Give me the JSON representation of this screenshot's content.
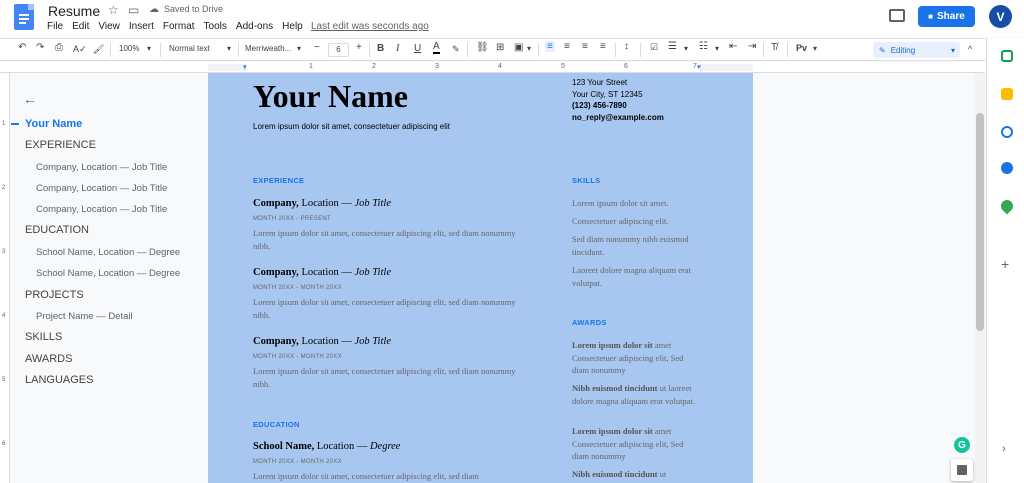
{
  "app": {
    "doc_title": "Resume",
    "saved_status": "Saved to Drive",
    "last_edit": "Last edit was seconds ago",
    "share_label": "Share",
    "avatar_initial": "V",
    "accent_color": "#1a73e8",
    "page_highlight_color": "#a8c7f0"
  },
  "menu": [
    "File",
    "Edit",
    "View",
    "Insert",
    "Format",
    "Tools",
    "Add-ons",
    "Help"
  ],
  "toolbar": {
    "zoom": "100%",
    "style": "Normal text",
    "font": "Merriweath...",
    "font_size": "6",
    "mode": "Editing"
  },
  "ruler": {
    "numbers": [
      "1",
      "1",
      "2",
      "3",
      "4",
      "5",
      "6",
      "7"
    ]
  },
  "vruler": {
    "numbers": [
      "1",
      "2",
      "3",
      "4",
      "5",
      "6"
    ]
  },
  "outline": {
    "active": "Your Name",
    "items": [
      {
        "level": "h",
        "label": "EXPERIENCE"
      },
      {
        "level": "s",
        "label": "Company, Location — Job Title"
      },
      {
        "level": "s",
        "label": "Company, Location — Job Title"
      },
      {
        "level": "s",
        "label": "Company, Location — Job Title"
      },
      {
        "level": "h",
        "label": "EDUCATION"
      },
      {
        "level": "s",
        "label": "School Name, Location — Degree"
      },
      {
        "level": "s",
        "label": "School Name, Location — Degree"
      },
      {
        "level": "h",
        "label": "PROJECTS"
      },
      {
        "level": "s",
        "label": "Project Name — Detail"
      },
      {
        "level": "h",
        "label": "SKILLS"
      },
      {
        "level": "h",
        "label": "AWARDS"
      },
      {
        "level": "h",
        "label": "LANGUAGES"
      }
    ]
  },
  "document": {
    "name": "Your Name",
    "tagline": "Lorem ipsum dolor sit amet, consectetuer adipiscing elit",
    "contact": {
      "street": "123 Your Street",
      "city": "Your City, ST 12345",
      "phone": "(123) 456-7890",
      "email": "no_reply@example.com"
    },
    "experience_heading": "EXPERIENCE",
    "jobs": [
      {
        "company": "Company,",
        "location": " Location — ",
        "title": "Job Title",
        "dates": "MONTH 20XX - PRESENT",
        "desc": "Lorem ipsum dolor sit amet, consectetuer adipiscing elit, sed diam nonummy nibh."
      },
      {
        "company": "Company,",
        "location": " Location — ",
        "title": "Job Title",
        "dates": "MONTH 20XX - MONTH 20XX",
        "desc": "Lorem ipsum dolor sit amet, consectetuer adipiscing elit, sed diam nonummy nibh."
      },
      {
        "company": "Company,",
        "location": " Location — ",
        "title": "Job Title",
        "dates": "MONTH 20XX - MONTH 20XX",
        "desc": "Lorem ipsum dolor sit amet, consectetuer adipiscing elit, sed diam nonummy nibh."
      }
    ],
    "education_heading": "EDUCATION",
    "school": {
      "name": "School Name,",
      "location": " Location — ",
      "degree": "Degree",
      "dates": "MONTH 20XX - MONTH 20XX",
      "desc": "Lorem ipsum dolor sit amet, consectetuer adipiscing elit, sed diam"
    },
    "skills_heading": "SKILLS",
    "skills": [
      "Lorem ipsum dolor sit amet.",
      "Consectetuer adipiscing elit.",
      "Sed diam nonummy nibh euismod tincidunt.",
      "Laoreet dolore magna aliquam erat volutpat."
    ],
    "awards_heading": "AWARDS",
    "awards": [
      {
        "bold": "Lorem ipsum dolor sit",
        "rest": " amet Consectetuer adipiscing elit, Sed diam nonummy"
      },
      {
        "bold": "Nibh euismod tincidunt",
        "rest": " ut laoreet dolore magna aliquam erat volutpat."
      },
      {
        "bold": "Lorem ipsum dolor sit",
        "rest": " amet Consectetuer adipiscing elit, Sed diam nonummy"
      },
      {
        "bold": "Nibh euismod tincidunt",
        "rest": " ut"
      }
    ]
  },
  "grammarly_letter": "G"
}
